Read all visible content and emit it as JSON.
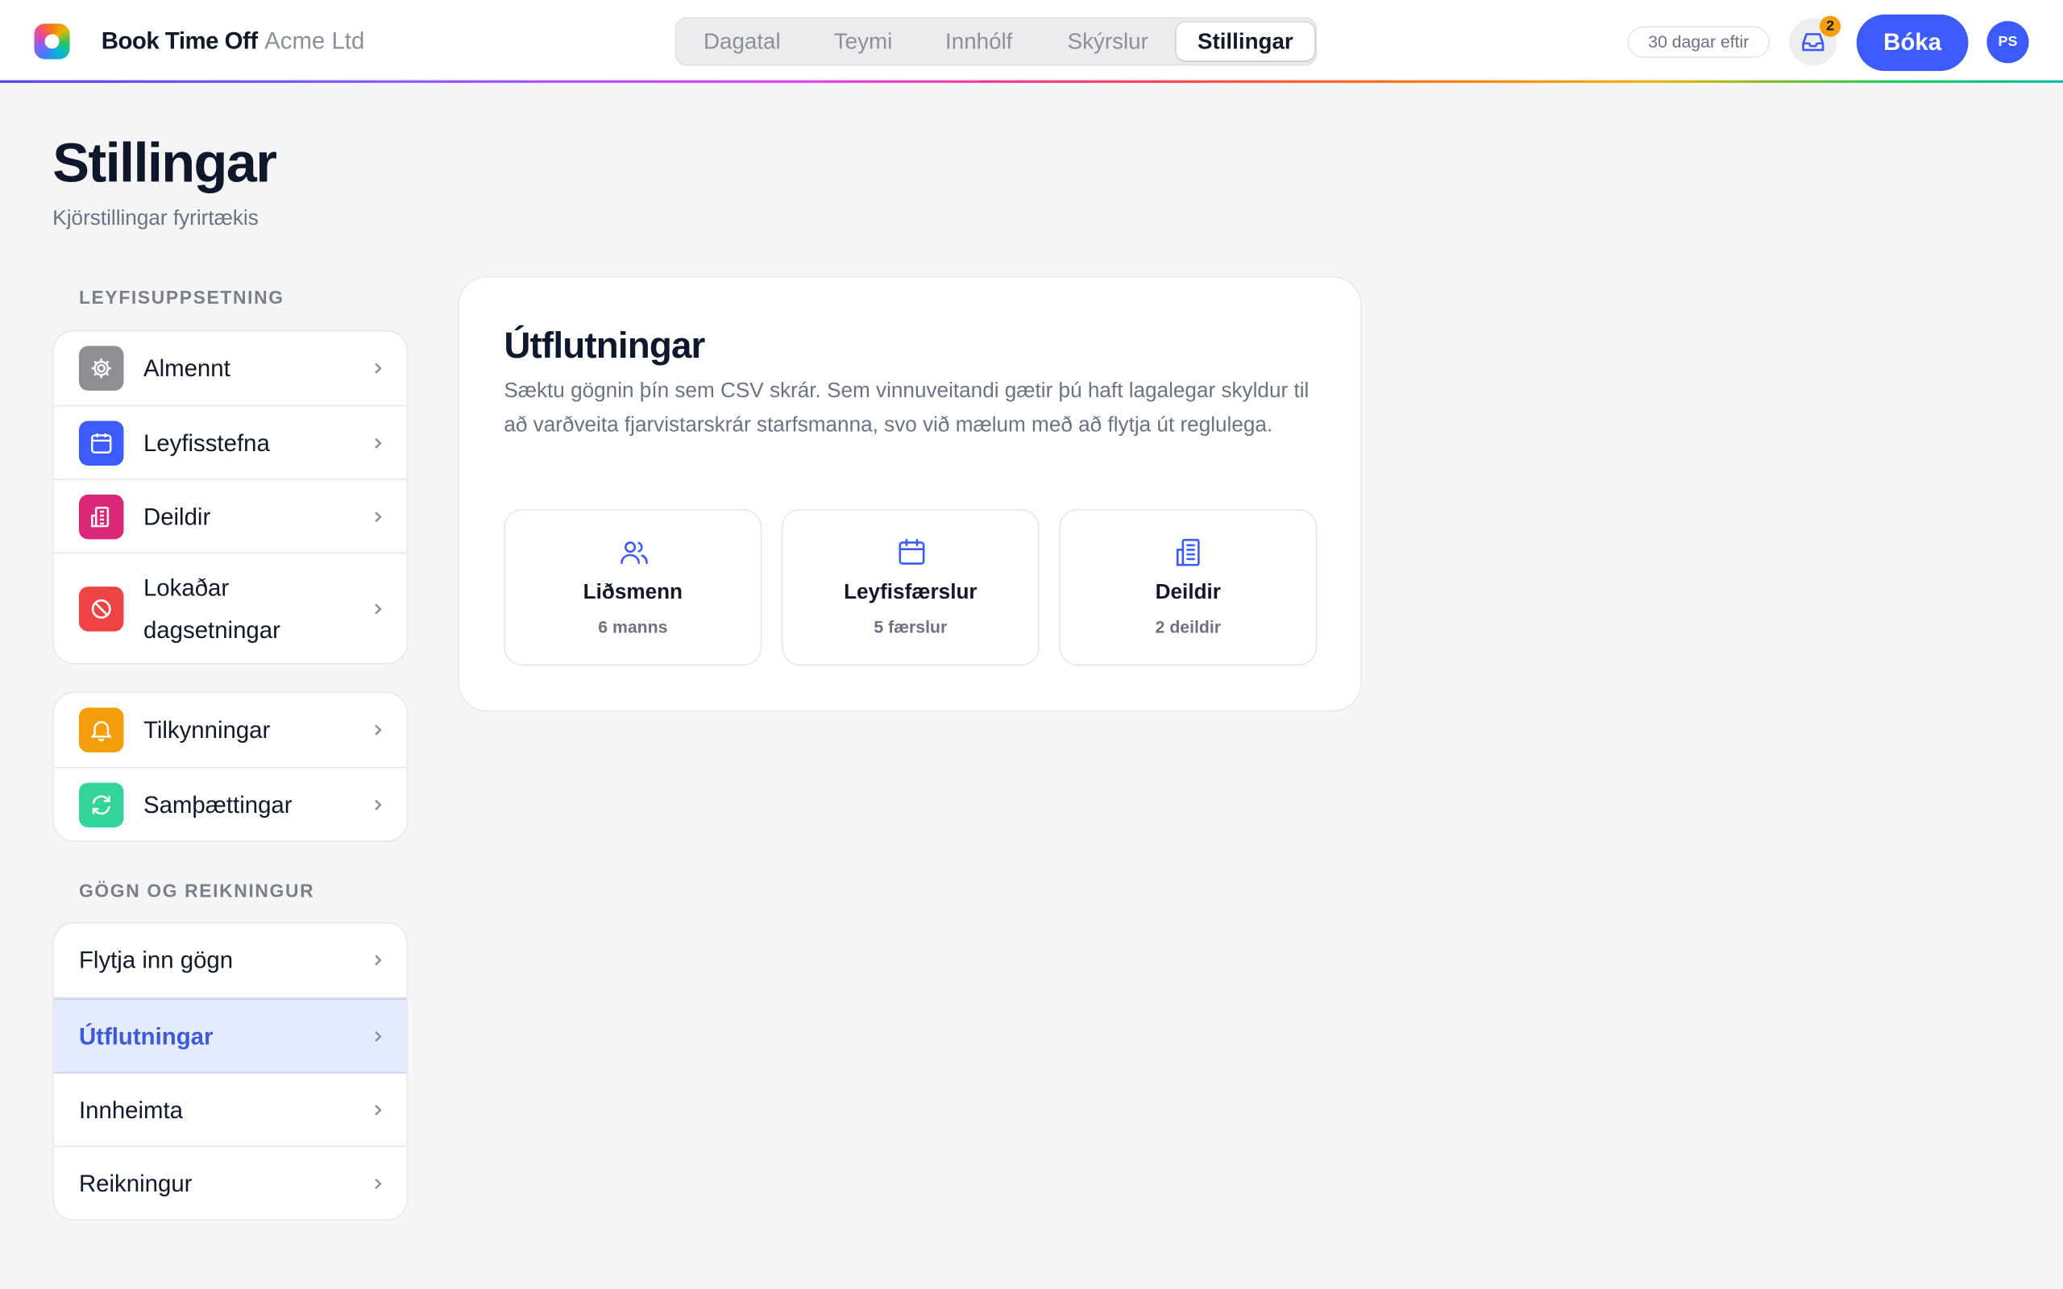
{
  "header": {
    "app_name": "Book Time Off",
    "org_name": "Acme Ltd",
    "tabs": [
      {
        "label": "Dagatal",
        "active": false
      },
      {
        "label": "Teymi",
        "active": false
      },
      {
        "label": "Innhólf",
        "active": false
      },
      {
        "label": "Skýrslur",
        "active": false
      },
      {
        "label": "Stillingar",
        "active": true
      }
    ],
    "days_left": "30 dagar eftir",
    "inbox_count": "2",
    "book_label": "Bóka",
    "avatar_initials": "PS"
  },
  "page": {
    "title": "Stillingar",
    "subtitle": "Kjörstillingar fyrirtækis"
  },
  "sidebar": {
    "section1_label": "LEYFISUPPSETNING",
    "group1": [
      {
        "label": "Almennt",
        "icon": "gear-icon",
        "color": "#8e8e93"
      },
      {
        "label": "Leyfisstefna",
        "icon": "calendar-icon",
        "color": "#3b5bfd"
      },
      {
        "label": "Deildir",
        "icon": "building-icon",
        "color": "#db2777"
      },
      {
        "label": "Lokaðar dagsetningar",
        "icon": "block-icon",
        "color": "#ef4444"
      }
    ],
    "group2": [
      {
        "label": "Tilkynningar",
        "icon": "bell-icon",
        "color": "#f59e0b"
      },
      {
        "label": "Samþættingar",
        "icon": "sync-icon",
        "color": "#34d399"
      }
    ],
    "section2_label": "GÖGN OG REIKNINGUR",
    "group3": [
      {
        "label": "Flytja inn gögn",
        "active": false
      },
      {
        "label": "Útflutningar",
        "active": true
      },
      {
        "label": "Innheimta",
        "active": false
      },
      {
        "label": "Reikningur",
        "active": false
      }
    ]
  },
  "main": {
    "title": "Útflutningar",
    "description": "Sæktu gögnin þín sem CSV skrár. Sem vinnuveitandi gætir þú haft lagalegar skyldur til að varðveita fjarvistarskrár starfsmanna, svo við mælum með að flytja út reglulega.",
    "tiles": [
      {
        "title": "Liðsmenn",
        "sub": "6 manns",
        "icon": "users-icon"
      },
      {
        "title": "Leyfisfærslur",
        "sub": "5 færslur",
        "icon": "calendar-icon"
      },
      {
        "title": "Deildir",
        "sub": "2 deildir",
        "icon": "building-icon"
      }
    ]
  },
  "colors": {
    "accent": "#3b5bfd",
    "active_bg": "#e6eafe",
    "badge": "#f59e0b"
  }
}
